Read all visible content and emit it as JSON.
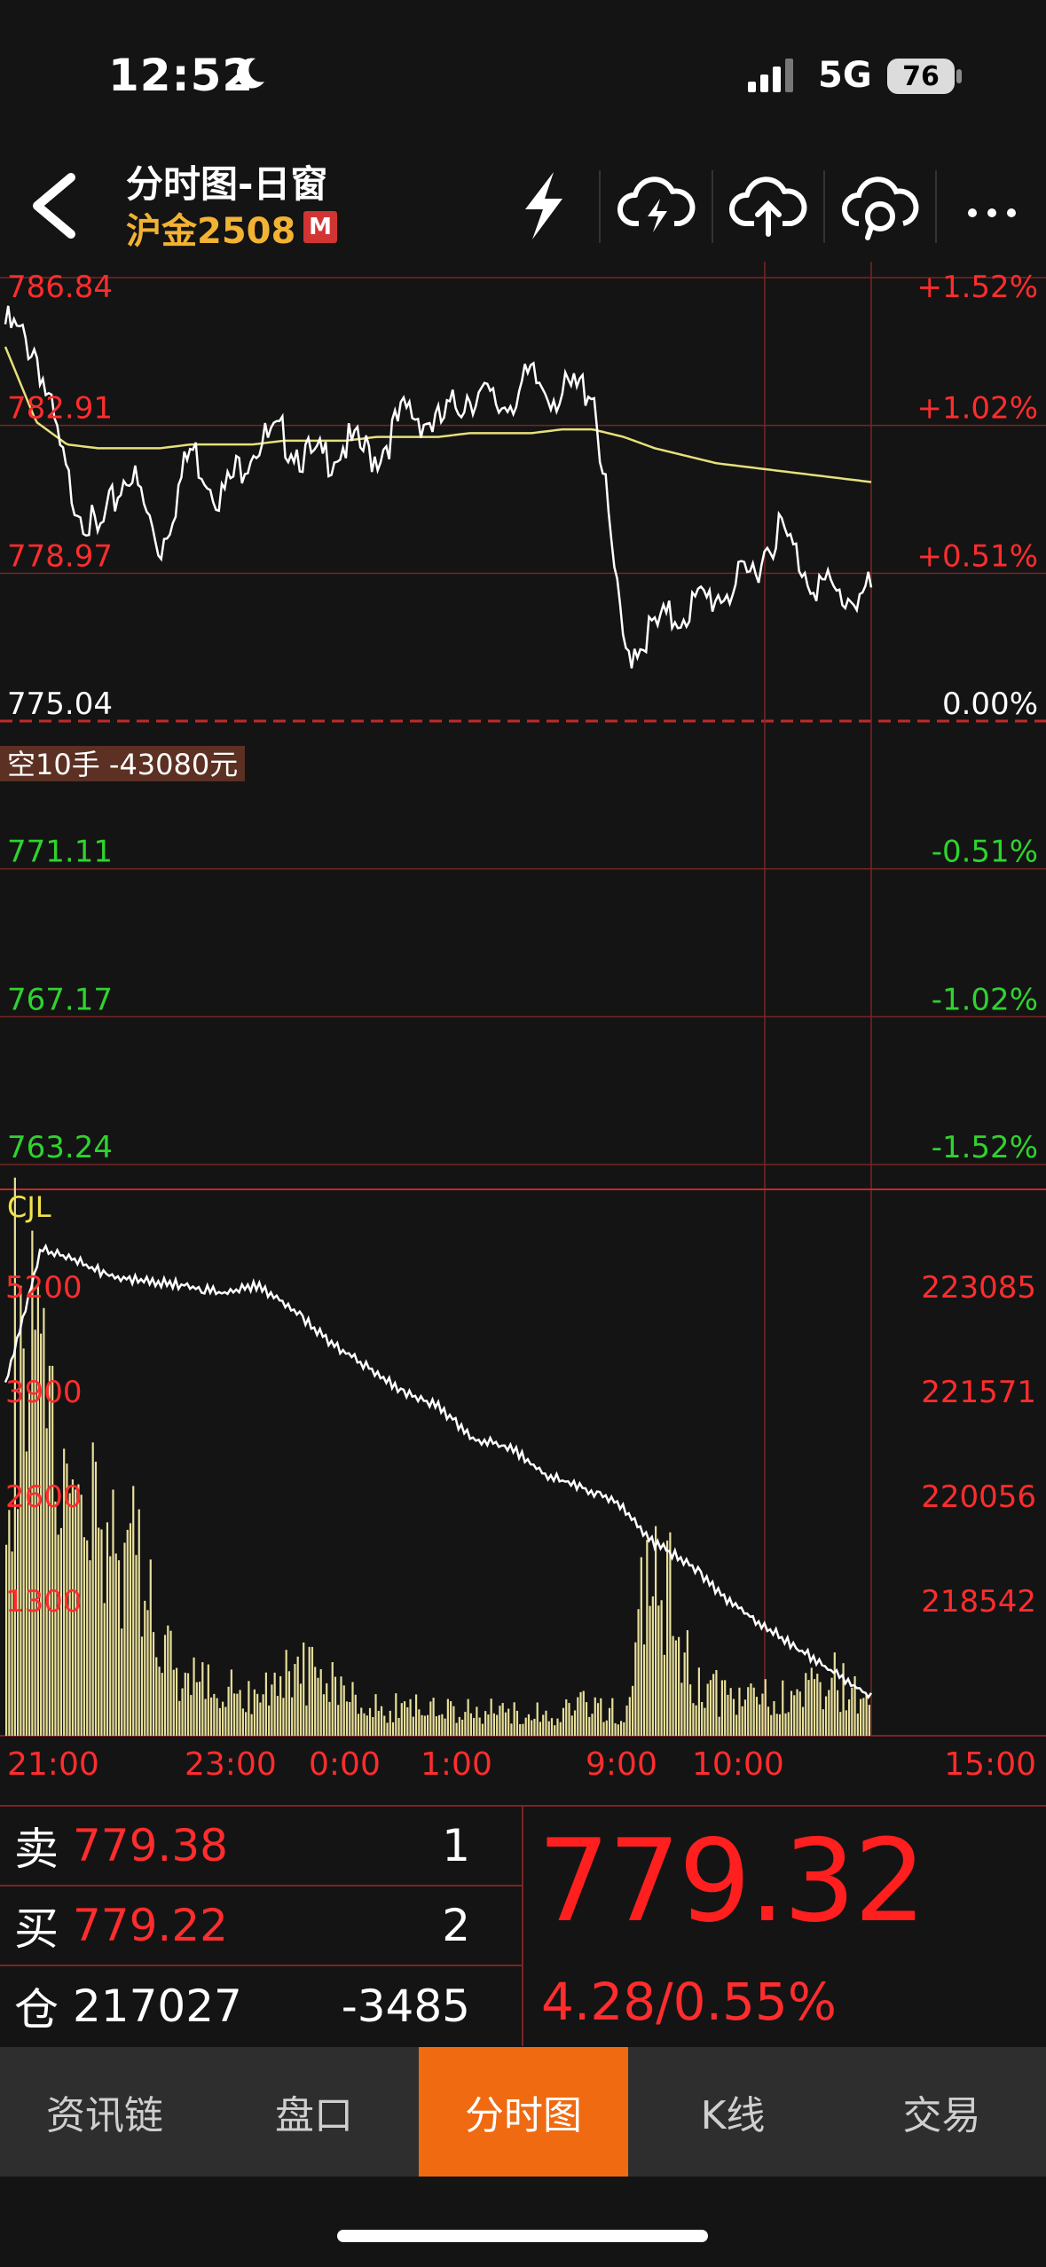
{
  "status_bar": {
    "time": "12:52",
    "network": "5G",
    "battery": "76"
  },
  "header": {
    "title": "分时图-日窗",
    "contract_prefix": "沪金",
    "contract_code": "2508",
    "badge": "M"
  },
  "chart": {
    "price_levels": [
      {
        "price": "786.84",
        "pct": "+1.52%",
        "color": "#ff2d2d"
      },
      {
        "price": "782.91",
        "pct": "+1.02%",
        "color": "#ff2d2d"
      },
      {
        "price": "778.97",
        "pct": "+0.51%",
        "color": "#ff2d2d"
      },
      {
        "price": "775.04",
        "pct": "0.00%",
        "color": "#ffffff"
      },
      {
        "price": "771.11",
        "pct": "-0.51%",
        "color": "#2fd32f"
      },
      {
        "price": "767.17",
        "pct": "-1.02%",
        "color": "#2fd32f"
      },
      {
        "price": "763.24",
        "pct": "-1.52%",
        "color": "#2fd32f"
      }
    ],
    "position_tag": "空10手 -43080元",
    "volume_label": "CJL",
    "volume_levels": [
      {
        "vol": "5200",
        "oi": "223085"
      },
      {
        "vol": "3900",
        "oi": "221571"
      },
      {
        "vol": "2600",
        "oi": "220056"
      },
      {
        "vol": "1300",
        "oi": "218542"
      }
    ],
    "time_labels": [
      "21:00",
      "23:00",
      "0:00",
      "1:00",
      "9:00",
      "10:00",
      "15:00"
    ],
    "colors": {
      "price_line": "#ffffff",
      "avg_line": "#e6e07a",
      "volume": "#e8df9a",
      "grid": "#7a2424",
      "up": "#ff2d2d",
      "down": "#2fd32f"
    }
  },
  "chart_data": {
    "type": "line",
    "series": [
      {
        "values": [
          785.6,
          784.9,
          781.4,
          779.9,
          781.8,
          779.6,
          782.3,
          781.0,
          782.4,
          782.6,
          781.9,
          782.4,
          782.1,
          783.3,
          782.9,
          783.8,
          783.4,
          784.1,
          783.7,
          784.0,
          776.8,
          777.5,
          778.0,
          778.4,
          778.8,
          780.2,
          778.9,
          778.3,
          778.5
        ]
      },
      {
        "values": [
          785.0,
          783.0,
          782.4,
          782.3,
          782.3,
          782.3,
          782.4,
          782.4,
          782.4,
          782.5,
          782.5,
          782.5,
          782.6,
          782.6,
          782.6,
          782.7,
          782.7,
          782.7,
          782.8,
          782.8,
          782.6,
          782.3,
          782.1,
          781.9,
          781.8,
          781.7,
          781.6,
          781.5,
          781.4
        ]
      }
    ],
    "volume": [
      5000,
      4200,
      3000,
      2200,
      2800,
      3000,
      2000,
      900,
      700,
      600,
      500,
      550,
      600,
      800,
      700,
      500,
      400,
      300,
      350,
      300,
      300,
      280,
      320,
      250,
      260,
      270,
      350,
      300,
      280,
      2500,
      1500,
      600,
      500,
      400,
      450,
      500,
      600,
      700,
      500,
      400
    ],
    "open_interest": [
      221400,
      223050,
      222900,
      222700,
      222650,
      222600,
      222500,
      222600,
      222300,
      221900,
      221600,
      221300,
      221100,
      220700,
      220600,
      220250,
      220100,
      219900,
      219400,
      219150,
      218700,
      218400,
      218100,
      217800,
      217500
    ],
    "ylim": [
      763.24,
      786.84
    ],
    "volume_ylim": [
      0,
      6500
    ],
    "oi_ylim": [
      217027,
      223085
    ]
  },
  "quote": {
    "sell_label": "卖",
    "sell_price": "779.38",
    "sell_qty": "1",
    "buy_label": "买",
    "buy_price": "779.22",
    "buy_qty": "2",
    "oi_label": "仓",
    "oi_value": "217027",
    "oi_change": "-3485",
    "last_price": "779.32",
    "change": "4.28/0.55%"
  },
  "tabs": [
    {
      "label": "资讯链",
      "active": false
    },
    {
      "label": "盘口",
      "active": false
    },
    {
      "label": "分时图",
      "active": true
    },
    {
      "label": "K线",
      "active": false
    },
    {
      "label": "交易",
      "active": false
    }
  ]
}
